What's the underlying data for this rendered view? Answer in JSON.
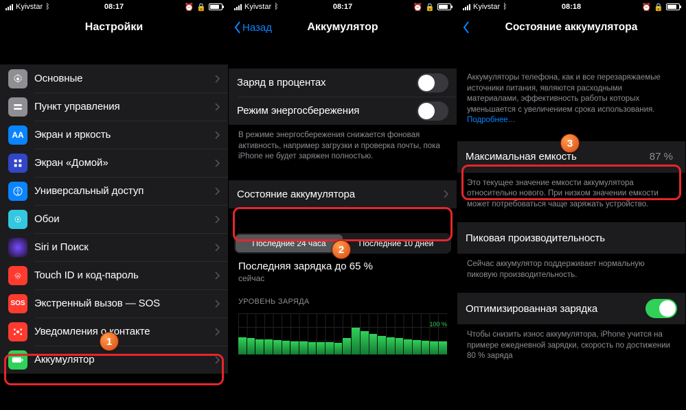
{
  "screens": [
    {
      "status": {
        "carrier": "Kyivstar",
        "time": "08:17"
      },
      "title": "Настройки",
      "items": [
        {
          "id": "general",
          "label": "Основные"
        },
        {
          "id": "control",
          "label": "Пункт управления"
        },
        {
          "id": "display",
          "label": "Экран и яркость"
        },
        {
          "id": "home",
          "label": "Экран «Домой»"
        },
        {
          "id": "access",
          "label": "Универсальный доступ"
        },
        {
          "id": "wallpaper",
          "label": "Обои"
        },
        {
          "id": "siri",
          "label": "Siri и Поиск"
        },
        {
          "id": "touchid",
          "label": "Touch ID и код-пароль"
        },
        {
          "id": "sos",
          "label": "Экстренный вызов — SOS",
          "sos": "SOS"
        },
        {
          "id": "notif",
          "label": "Уведомления о контакте"
        },
        {
          "id": "battery",
          "label": "Аккумулятор"
        }
      ]
    },
    {
      "status": {
        "carrier": "Kyivstar",
        "time": "08:17"
      },
      "back": "Назад",
      "title": "Аккумулятор",
      "toggles": [
        {
          "label": "Заряд в процентах",
          "on": false
        },
        {
          "label": "Режим энергосбережения",
          "on": false
        }
      ],
      "caption": "В режиме энергосбережения снижается фоновая активность, например загрузки и проверка почты, пока iPhone не будет заряжен полностью.",
      "health_label": "Состояние аккумулятора",
      "segments": [
        "Последние 24 часа",
        "Последние 10 дней"
      ],
      "last_charge": "Последняя зарядка до 65 %",
      "last_charge_sub": "сейчас",
      "chart_caption": "УРОВЕНЬ ЗАРЯДА",
      "chart_max": "100 %"
    },
    {
      "status": {
        "carrier": "Kyivstar",
        "time": "08:18"
      },
      "title": "Состояние аккумулятора",
      "intro": "Аккумуляторы телефона, как и все перезаряжаемые источники питания, являются расходными материалами, эффективность работы которых уменьшается с увеличением срока использования. ",
      "intro_link": "Подробнее…",
      "max_cap_label": "Максимальная емкость",
      "max_cap_value": "87 %",
      "max_cap_desc": "Это текущее значение емкости аккумулятора относительно нового. При низком значении емкости может потребоваться чаще заряжать устройство.",
      "peak_label": "Пиковая производительность",
      "peak_desc": "Сейчас аккумулятор поддерживает нормальную пиковую производительность.",
      "opt_label": "Оптимизированная зарядка",
      "opt_desc": "Чтобы снизить износ аккумулятора, iPhone учится на примере ежедневной зарядки, скорость по достижении 80 % заряда"
    }
  ],
  "chart_data": {
    "type": "bar",
    "title": "УРОВЕНЬ ЗАРЯДА",
    "ylabel": "%",
    "ylim": [
      0,
      100
    ],
    "values": [
      42,
      40,
      38,
      37,
      35,
      34,
      33,
      32,
      31,
      30,
      30,
      29,
      40,
      65,
      58,
      50,
      45,
      42,
      40,
      38,
      36,
      34,
      33,
      32
    ]
  }
}
